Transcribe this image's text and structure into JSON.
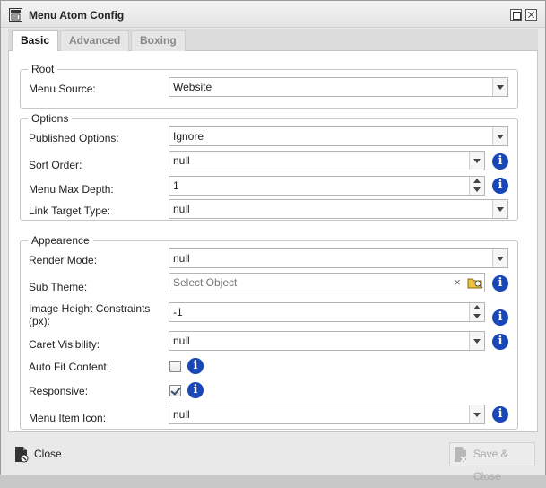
{
  "window": {
    "title": "Menu Atom Config"
  },
  "tabs": [
    {
      "label": "Basic",
      "active": true
    },
    {
      "label": "Advanced",
      "active": false
    },
    {
      "label": "Boxing",
      "active": false
    }
  ],
  "root": {
    "legend": "Root",
    "menu_source": {
      "label": "Menu Source:",
      "value": "Website"
    }
  },
  "options": {
    "legend": "Options",
    "published_options": {
      "label": "Published Options:",
      "value": "Ignore"
    },
    "sort_order": {
      "label": "Sort Order:",
      "value": "null"
    },
    "menu_max_depth": {
      "label": "Menu Max Depth:",
      "value": "1"
    },
    "link_target_type": {
      "label": "Link Target Type:",
      "value": "null"
    }
  },
  "appearance": {
    "legend": "Appearence",
    "render_mode": {
      "label": "Render Mode:",
      "value": "null"
    },
    "sub_theme": {
      "label": "Sub Theme:",
      "placeholder": "Select Object",
      "clear": "×"
    },
    "image_height": {
      "label_line1": "Image Height Constraints",
      "label_line2": "(px):",
      "value": "-1"
    },
    "caret_visibility": {
      "label": "Caret Visibility:",
      "value": "null"
    },
    "auto_fit_content": {
      "label": "Auto Fit Content:",
      "checked": false
    },
    "responsive": {
      "label": "Responsive:",
      "checked": true
    },
    "menu_item_icon": {
      "label": "Menu Item Icon:",
      "value": "null"
    }
  },
  "info_glyph": "i",
  "footer": {
    "close_label": "Close",
    "save_close_label": "Save & Close",
    "save_close_enabled": false
  },
  "colors": {
    "info_blue": "#1a47b8",
    "disabled_text": "#a8a8a8"
  },
  "icons": {
    "title": "atom-config-icon",
    "close": "document-close-icon",
    "save": "document-save-icon",
    "browse": "folder-browse-icon",
    "info": "info-icon"
  }
}
